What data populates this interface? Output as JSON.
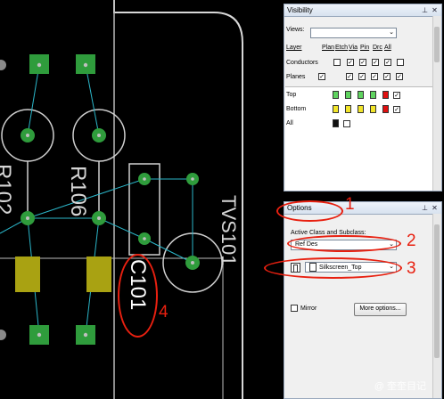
{
  "board": {
    "refdes_r102": "R102",
    "refdes_r106": "R106",
    "refdes_c101": "C101",
    "refdes_tvs101": "TVS101"
  },
  "visibility": {
    "title": "Visibility",
    "views_label": "Views:",
    "views_value": "",
    "headers": [
      "Layer",
      "Plan",
      "Etch",
      "Via",
      "Pin",
      "Drc",
      "All"
    ],
    "conductors_label": "Conductors",
    "planes_label": "Planes",
    "layers": [
      {
        "name": "Top",
        "colors": [
          "#5fd35f",
          "#5fd35f",
          "#5fd35f",
          "#5fd35f",
          "#e01010"
        ]
      },
      {
        "name": "Bottom",
        "colors": [
          "#f2e52a",
          "#f2e52a",
          "#f2e52a",
          "#f2e52a",
          "#e01010"
        ]
      },
      {
        "name": "All",
        "colors": [
          "#111111"
        ]
      }
    ]
  },
  "options": {
    "title": "Options",
    "active_class_label": "Active Class and Subclass:",
    "class_value": "Ref Des",
    "subclass_value": "Silkscreen_Top",
    "mirror_label": "Mirror",
    "more_options_label": "More options..."
  },
  "annotations": [
    "1",
    "2",
    "3",
    "4"
  ],
  "watermark": "@ 奎奎目记"
}
